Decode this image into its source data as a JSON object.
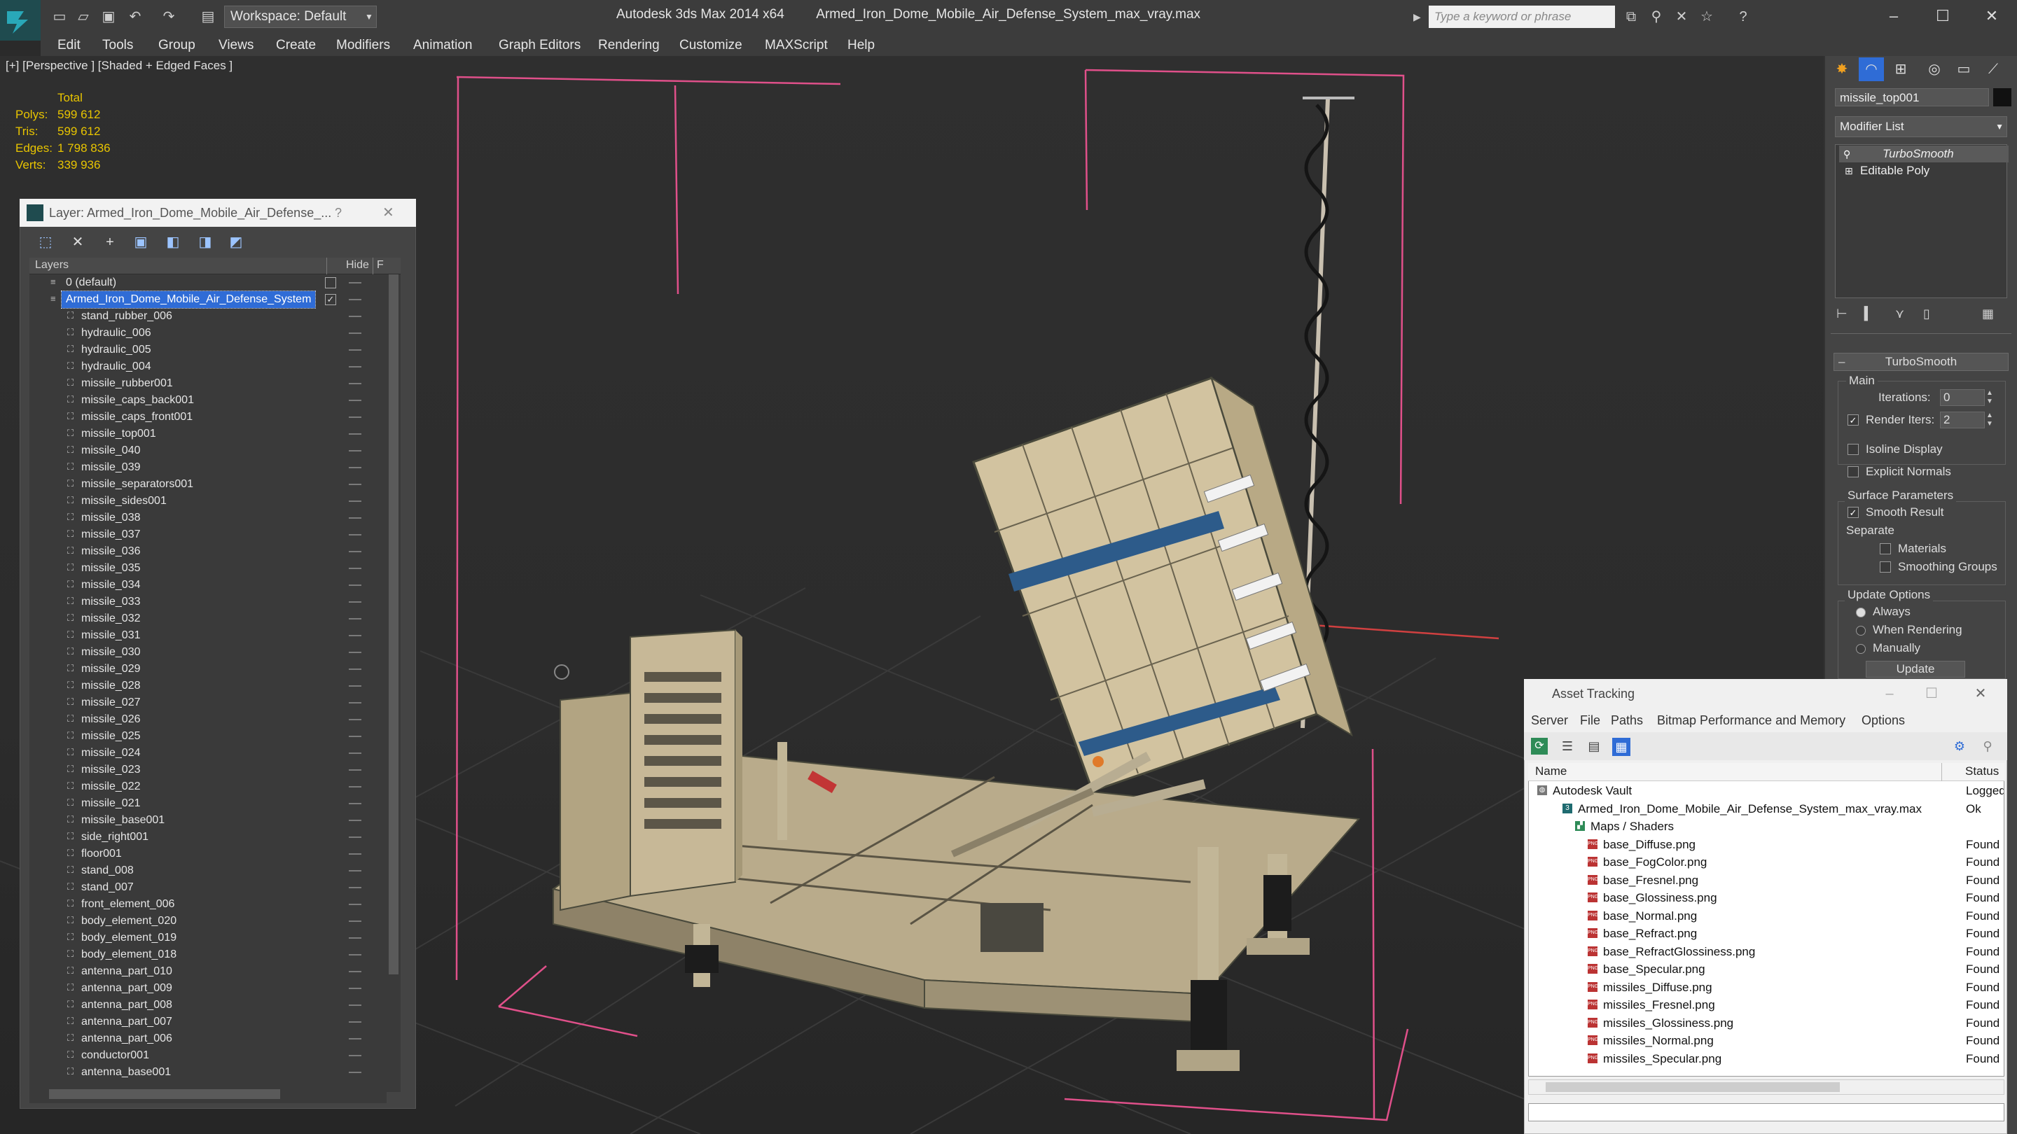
{
  "titlebar": {
    "workspace": "Workspace: Default",
    "app": "Autodesk 3ds Max  2014 x64",
    "file": "Armed_Iron_Dome_Mobile_Air_Defense_System_max_vray.max",
    "search_placeholder": "Type a keyword or phrase"
  },
  "menu": [
    "Edit",
    "Tools",
    "Group",
    "Views",
    "Create",
    "Modifiers",
    "Animation",
    "Graph Editors",
    "Rendering",
    "Customize",
    "MAXScript",
    "Help"
  ],
  "viewport": {
    "label": "[+] [Perspective ] [Shaded + Edged Faces ]",
    "stats": {
      "total_label": "Total",
      "rows": [
        {
          "label": "Polys:",
          "value": "599 612"
        },
        {
          "label": "Tris:",
          "value": "599 612"
        },
        {
          "label": "Edges:",
          "value": "1 798 836"
        },
        {
          "label": "Verts:",
          "value": "339 936"
        }
      ]
    }
  },
  "layer_explorer": {
    "title": "Layer: Armed_Iron_Dome_Mobile_Air_Defense_...",
    "help": "?",
    "close": "✕",
    "col_layers": "Layers",
    "col_hide": "Hide",
    "col_freeze": "F",
    "default_layer": "0 (default)",
    "active_layer": "Armed_Iron_Dome_Mobile_Air_Defense_System",
    "objects": [
      "stand_rubber_006",
      "hydraulic_006",
      "hydraulic_005",
      "hydraulic_004",
      "missile_rubber001",
      "missile_caps_back001",
      "missile_caps_front001",
      "missile_top001",
      "missile_040",
      "missile_039",
      "missile_separators001",
      "missile_sides001",
      "missile_038",
      "missile_037",
      "missile_036",
      "missile_035",
      "missile_034",
      "missile_033",
      "missile_032",
      "missile_031",
      "missile_030",
      "missile_029",
      "missile_028",
      "missile_027",
      "missile_026",
      "missile_025",
      "missile_024",
      "missile_023",
      "missile_022",
      "missile_021",
      "missile_base001",
      "side_right001",
      "floor001",
      "stand_008",
      "stand_007",
      "front_element_006",
      "body_element_020",
      "body_element_019",
      "body_element_018",
      "antenna_part_010",
      "antenna_part_009",
      "antenna_part_008",
      "antenna_part_007",
      "antenna_part_006",
      "conductor001",
      "antenna_base001"
    ]
  },
  "command_panel": {
    "object_name": "missile_top001",
    "modifier_list": "Modifier List",
    "stack": [
      "TurboSmooth",
      "Editable Poly"
    ],
    "rollout_title": "TurboSmooth",
    "main_label": "Main",
    "iterations_label": "Iterations:",
    "iterations_value": "0",
    "render_iters_label": "Render Iters:",
    "render_iters_value": "2",
    "isoline": "Isoline Display",
    "explicit_normals": "Explicit Normals",
    "surface_params": "Surface Parameters",
    "smooth_result": "Smooth Result",
    "separate": "Separate",
    "materials": "Materials",
    "smoothing_groups": "Smoothing Groups",
    "update_options": "Update Options",
    "always": "Always",
    "when_rendering": "When Rendering",
    "manually": "Manually",
    "update_button": "Update"
  },
  "asset_tracking": {
    "title": "Asset Tracking",
    "menu": [
      "Server",
      "File",
      "Paths",
      "Bitmap Performance and Memory",
      "Options"
    ],
    "col_name": "Name",
    "col_status": "Status",
    "rows": [
      {
        "name": "Autodesk Vault",
        "status": "Logged O",
        "level": 0
      },
      {
        "name": "Armed_Iron_Dome_Mobile_Air_Defense_System_max_vray.max",
        "status": "Ok",
        "level": 1
      },
      {
        "name": "Maps / Shaders",
        "status": "",
        "level": 2
      },
      {
        "name": "base_Diffuse.png",
        "status": "Found",
        "level": 3
      },
      {
        "name": "base_FogColor.png",
        "status": "Found",
        "level": 3
      },
      {
        "name": "base_Fresnel.png",
        "status": "Found",
        "level": 3
      },
      {
        "name": "base_Glossiness.png",
        "status": "Found",
        "level": 3
      },
      {
        "name": "base_Normal.png",
        "status": "Found",
        "level": 3
      },
      {
        "name": "base_Refract.png",
        "status": "Found",
        "level": 3
      },
      {
        "name": "base_RefractGlossiness.png",
        "status": "Found",
        "level": 3
      },
      {
        "name": "base_Specular.png",
        "status": "Found",
        "level": 3
      },
      {
        "name": "missiles_Diffuse.png",
        "status": "Found",
        "level": 3
      },
      {
        "name": "missiles_Fresnel.png",
        "status": "Found",
        "level": 3
      },
      {
        "name": "missiles_Glossiness.png",
        "status": "Found",
        "level": 3
      },
      {
        "name": "missiles_Normal.png",
        "status": "Found",
        "level": 3
      },
      {
        "name": "missiles_Specular.png",
        "status": "Found",
        "level": 3
      }
    ]
  },
  "colors": {
    "selection": "#2f6cd6",
    "stats_yellow": "#e8c400",
    "bbox_pink": "#e0508a",
    "model_tan": "#d2c3a0"
  }
}
